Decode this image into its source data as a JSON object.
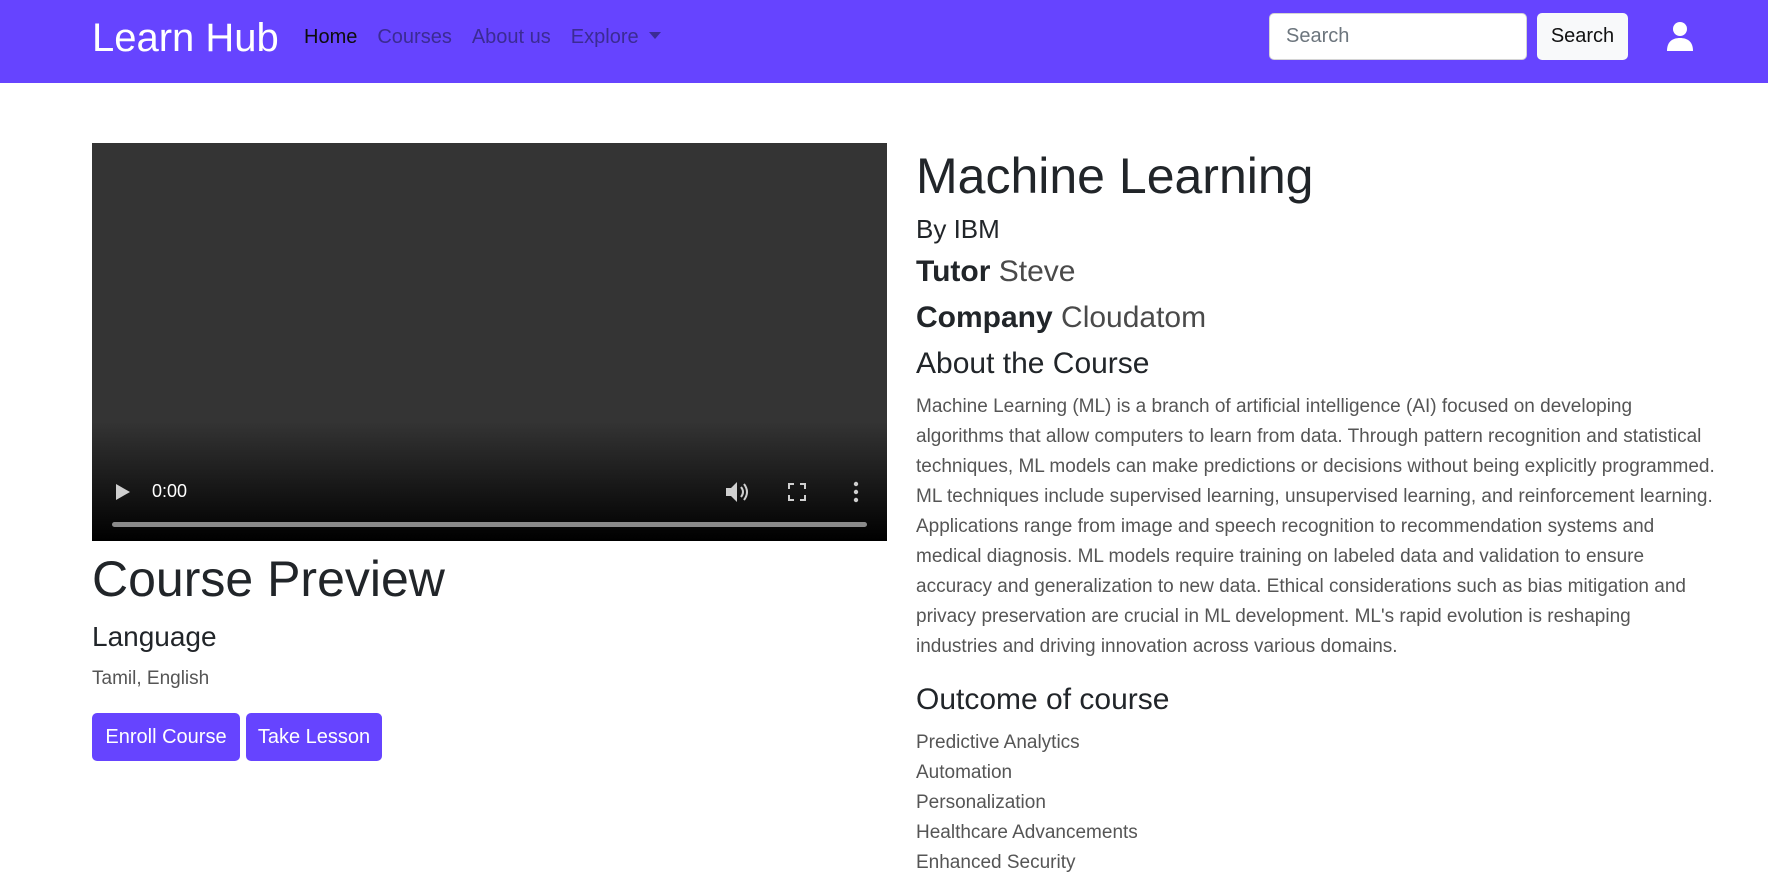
{
  "navbar": {
    "brand": "Learn Hub",
    "links": [
      {
        "label": "Home",
        "active": true
      },
      {
        "label": "Courses"
      },
      {
        "label": "About us"
      },
      {
        "label": "Explore"
      }
    ],
    "search_placeholder": "Search",
    "search_button": "Search",
    "user_icon": "user-icon"
  },
  "video": {
    "time": "0:00",
    "icons": [
      "play-icon",
      "volume-icon",
      "fullscreen-icon",
      "more-options-icon"
    ]
  },
  "preview": {
    "title": "Course Preview",
    "language_heading": "Language",
    "languages": "Tamil, English",
    "enroll_button": "Enroll Course",
    "lesson_button": "Take Lesson"
  },
  "course": {
    "title": "Machine Learning",
    "by": "By IBM",
    "tutor_label": "Tutor",
    "tutor": "Steve",
    "company_label": "Company",
    "company": "Cloudatom",
    "about_heading": "About the Course",
    "about_text": "Machine Learning (ML) is a branch of artificial intelligence (AI) focused on developing algorithms that allow computers to learn from data. Through pattern recognition and statistical techniques, ML models can make predictions or decisions without being explicitly programmed. ML techniques include supervised learning, unsupervised learning, and reinforcement learning. Applications range from image and speech recognition to recommendation systems and medical diagnosis. ML models require training on labeled data and validation to ensure accuracy and generalization to new data. Ethical considerations such as bias mitigation and privacy preservation are crucial in ML development. ML's rapid evolution is reshaping industries and driving innovation across various domains.",
    "outcome_heading": "Outcome of course",
    "outcomes": [
      "Predictive Analytics",
      "Automation",
      "Personalization",
      "Healthcare Advancements",
      "Enhanced Security"
    ]
  },
  "colors": {
    "brand_purple": "#6644ff",
    "nav_link": "#3b2b94"
  }
}
